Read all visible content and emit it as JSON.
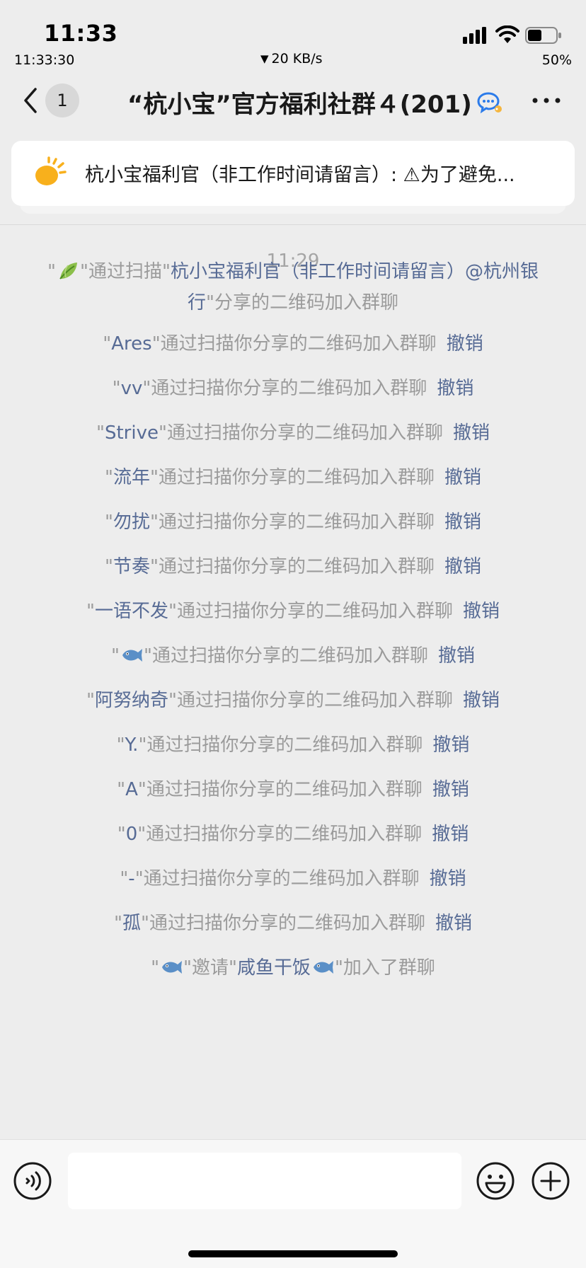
{
  "status_bar": {
    "time": "11:33",
    "seconds_time": "11:33:30",
    "network_speed": "20 KB/s",
    "battery_percent": "50%",
    "battery_level": 0.5
  },
  "nav": {
    "back_badge": "1",
    "title": "“杭小宝”官方福利社群４(201)"
  },
  "pinned": {
    "text": "杭小宝福利官（非工作时间请留言）: ⚠为了避免..."
  },
  "chat": {
    "time_divider": "11:29",
    "first_message": {
      "q1": "\"",
      "q2": "\"通过扫描\"",
      "inviter": "杭小宝福利官（非工作时间请留言）@杭州银行",
      "suffix": "\"分享的二维码加入群聊"
    },
    "join_suffix": "\"通过扫描你分享的二维码加入群聊",
    "revoke_label": "撤销",
    "quote_open": "\"",
    "joins": [
      {
        "name": "Ares",
        "icon": null
      },
      {
        "name": "vv",
        "icon": null
      },
      {
        "name": "Strive",
        "icon": null
      },
      {
        "name": "流年",
        "icon": null
      },
      {
        "name": "勿扰",
        "icon": null
      },
      {
        "name": "节奏",
        "icon": null
      },
      {
        "name": "一语不发",
        "icon": null
      },
      {
        "name": "",
        "icon": "fish-emoji"
      },
      {
        "name": "阿努纳奇",
        "icon": null
      },
      {
        "name": "Y.",
        "icon": null
      },
      {
        "name": "A",
        "icon": null
      },
      {
        "name": "0",
        "icon": null
      },
      {
        "name": "-",
        "icon": null
      },
      {
        "name": "孤",
        "icon": null
      }
    ],
    "last_message": {
      "q1": "\"",
      "q2": "\"邀请\"",
      "invitee": "咸鱼干饭",
      "suffix": "\"加入了群聊"
    }
  },
  "colors": {
    "name_link": "#576b95",
    "system_text": "#9b9b9b",
    "background": "#ededed"
  }
}
